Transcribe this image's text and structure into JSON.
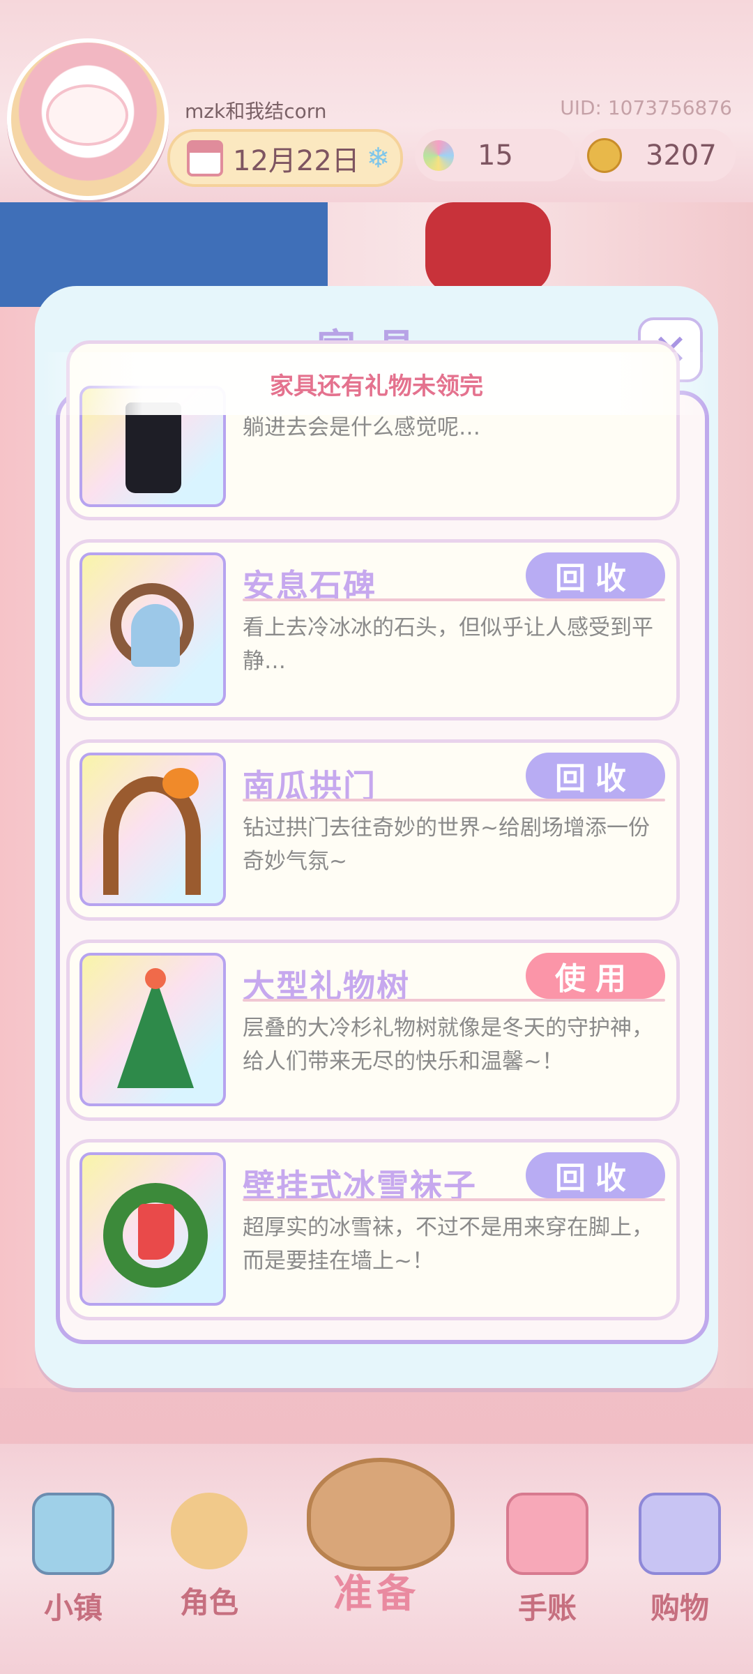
{
  "header": {
    "username": "mzk和我结corn",
    "uid": "UID: 1073756876",
    "date": "12月22日",
    "flowers": "15",
    "coins": "3207"
  },
  "panel": {
    "title": "家具",
    "notice": "家具还有礼物未领完",
    "close": "✕"
  },
  "items": [
    {
      "name": "",
      "desc": "躺进去会是什么感觉呢…",
      "button": ""
    },
    {
      "name": "安息石碑",
      "desc": "看上去冷冰冰的石头，但似乎让人感受到平静…",
      "button": "回收",
      "button_type": "recycle"
    },
    {
      "name": "南瓜拱门",
      "desc": "钻过拱门去往奇妙的世界~给剧场增添一份奇妙气氛~",
      "button": "回收",
      "button_type": "recycle"
    },
    {
      "name": "大型礼物树",
      "desc": "层叠的大冷杉礼物树就像是冬天的守护神，给人们带来无尽的快乐和温馨~！",
      "button": "使用",
      "button_type": "use"
    },
    {
      "name": "壁挂式冰雪袜子",
      "desc": "超厚实的冰雪袜，不过不是用来穿在脚上，而是要挂在墙上~！",
      "button": "回收",
      "button_type": "recycle"
    }
  ],
  "nav": {
    "town": "小镇",
    "role": "角色",
    "prepare": "准备",
    "journal": "手账",
    "shop": "购物"
  },
  "colors": {
    "accent_purple": "#b8acf3",
    "accent_pink": "#fb95a8",
    "notice_text": "#e4728e"
  }
}
